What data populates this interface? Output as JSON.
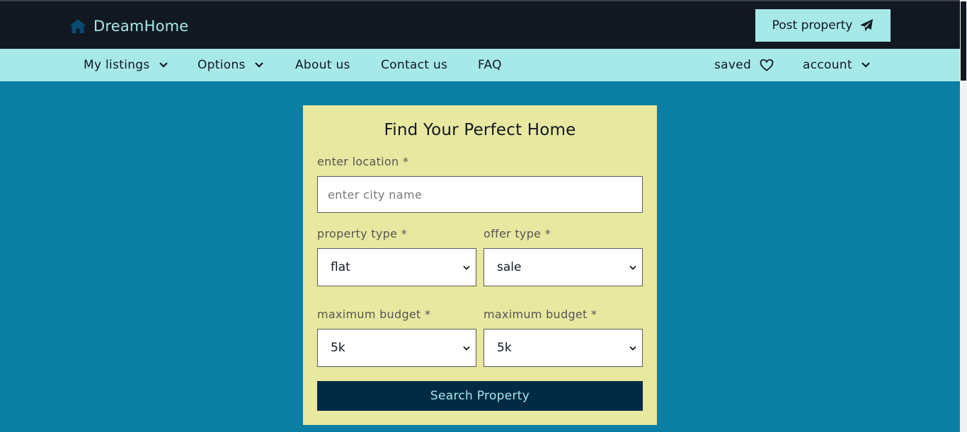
{
  "brand": {
    "name": "DreamHome",
    "icon": "home-icon"
  },
  "header": {
    "post_label": "Post property",
    "post_icon": "paper-plane-icon"
  },
  "nav": {
    "my_listings": "My listings",
    "options": "Options",
    "about": "About us",
    "contact": "Contact us",
    "faq": "FAQ",
    "saved": "saved",
    "account": "account"
  },
  "search_form": {
    "title": "Find Your Perfect Home",
    "location_label": "enter location *",
    "location_placeholder": "enter city name",
    "location_value": "",
    "property_type_label": "property type *",
    "property_type_value": "flat",
    "offer_type_label": "offer type *",
    "offer_type_value": "sale",
    "min_budget_label": "maximum budget *",
    "min_budget_value": "5k",
    "max_budget_label": "maximum budget *",
    "max_budget_value": "5k",
    "submit_label": "Search Property"
  },
  "colors": {
    "page_bg": "#0a7fa3",
    "header_bg": "#111821",
    "accent": "#a6e9e8",
    "card_bg": "#e8e8a0",
    "button_bg": "#002a44"
  }
}
